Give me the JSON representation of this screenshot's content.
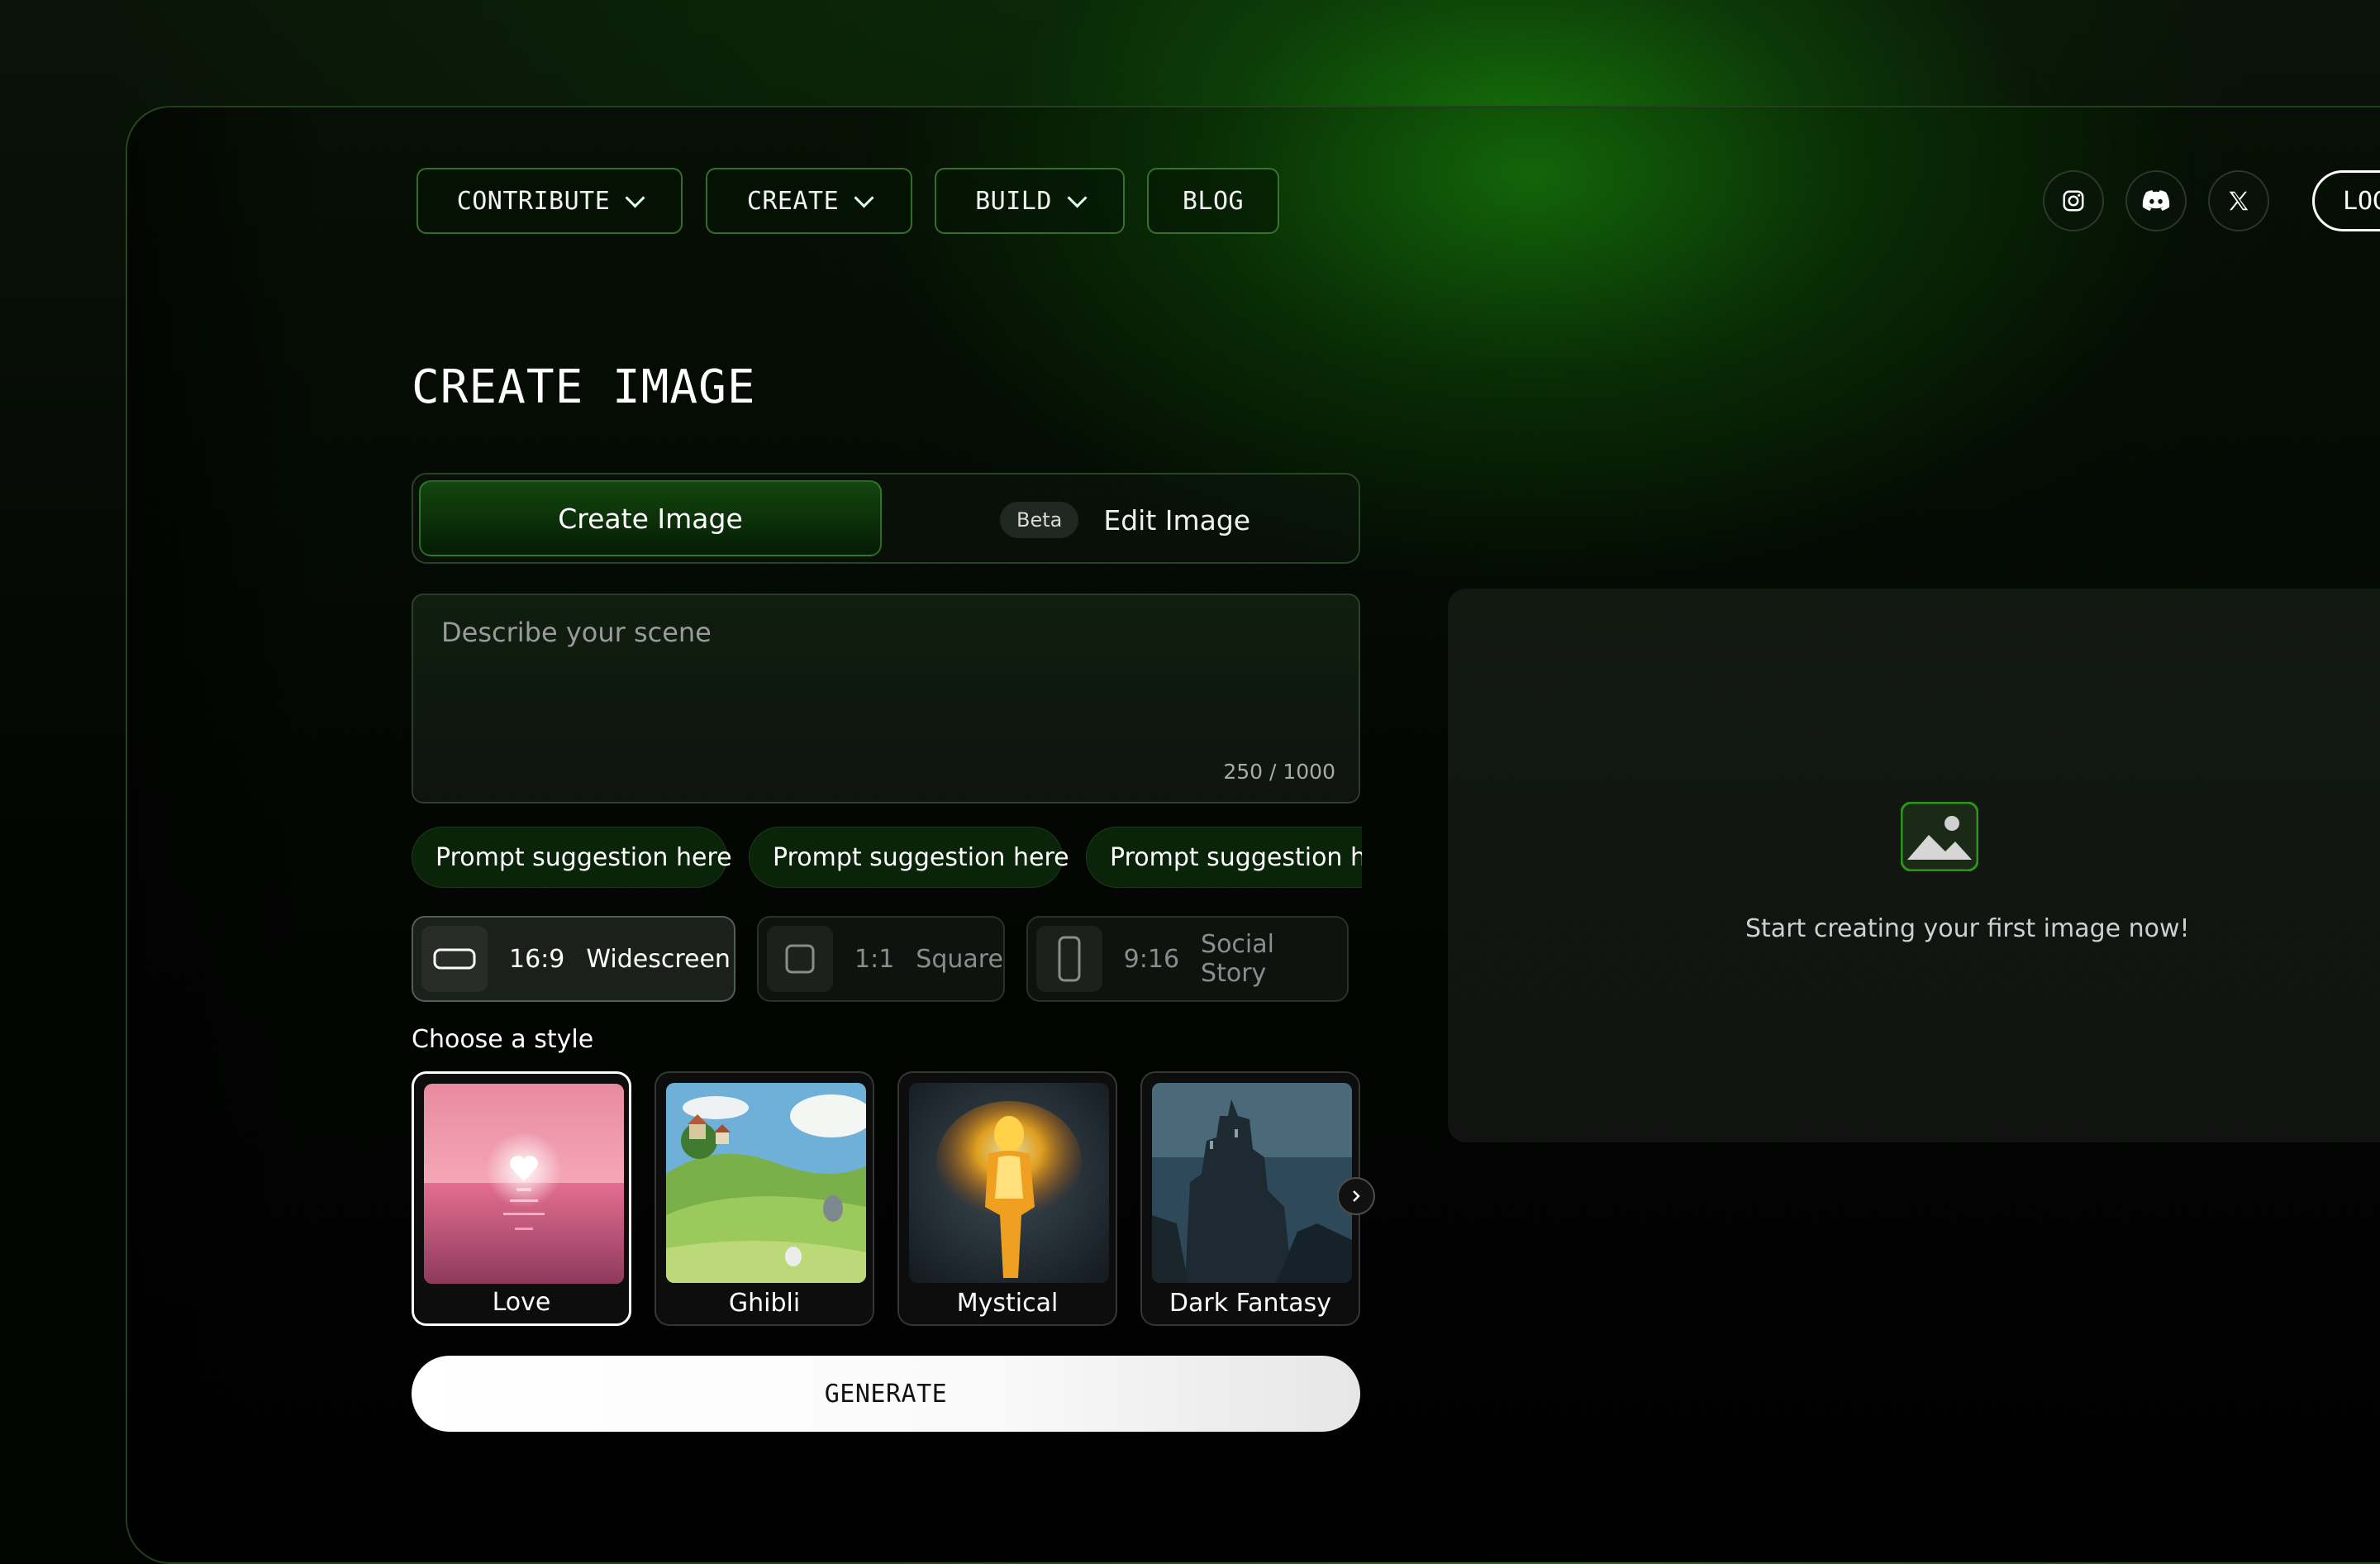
{
  "nav": {
    "items": [
      {
        "label": "CONTRIBUTE",
        "dropdown": true
      },
      {
        "label": "CREATE",
        "dropdown": true
      },
      {
        "label": "BUILD",
        "dropdown": true
      },
      {
        "label": "BLOG",
        "dropdown": false
      }
    ],
    "social": [
      "instagram-icon",
      "discord-icon",
      "x-icon"
    ],
    "login_label": "LOG"
  },
  "page": {
    "title": "CREATE IMAGE"
  },
  "tabs": {
    "create_label": "Create Image",
    "edit_label": "Edit Image",
    "beta_badge": "Beta",
    "active": "Create Image"
  },
  "prompt": {
    "placeholder": "Describe your scene",
    "value": "",
    "counter": "250 / 1000"
  },
  "suggestions": [
    "Prompt suggestion here",
    "Prompt suggestion here",
    "Prompt suggestion here"
  ],
  "ratios": [
    {
      "value": "16:9",
      "name": "Widescreen",
      "selected": true
    },
    {
      "value": "1:1",
      "name": "Square",
      "selected": false
    },
    {
      "value": "9:16",
      "name": "Social Story",
      "selected": false
    }
  ],
  "styles": {
    "label": "Choose a style",
    "items": [
      {
        "name": "Love",
        "selected": true
      },
      {
        "name": "Ghibli",
        "selected": false
      },
      {
        "name": "Mystical",
        "selected": false
      },
      {
        "name": "Dark Fantasy",
        "selected": false
      }
    ]
  },
  "generate_label": "GENERATE",
  "preview": {
    "empty_text": "Start creating your first image now!"
  },
  "colors": {
    "accent_green": "#1f8a12",
    "background": "#020402"
  }
}
